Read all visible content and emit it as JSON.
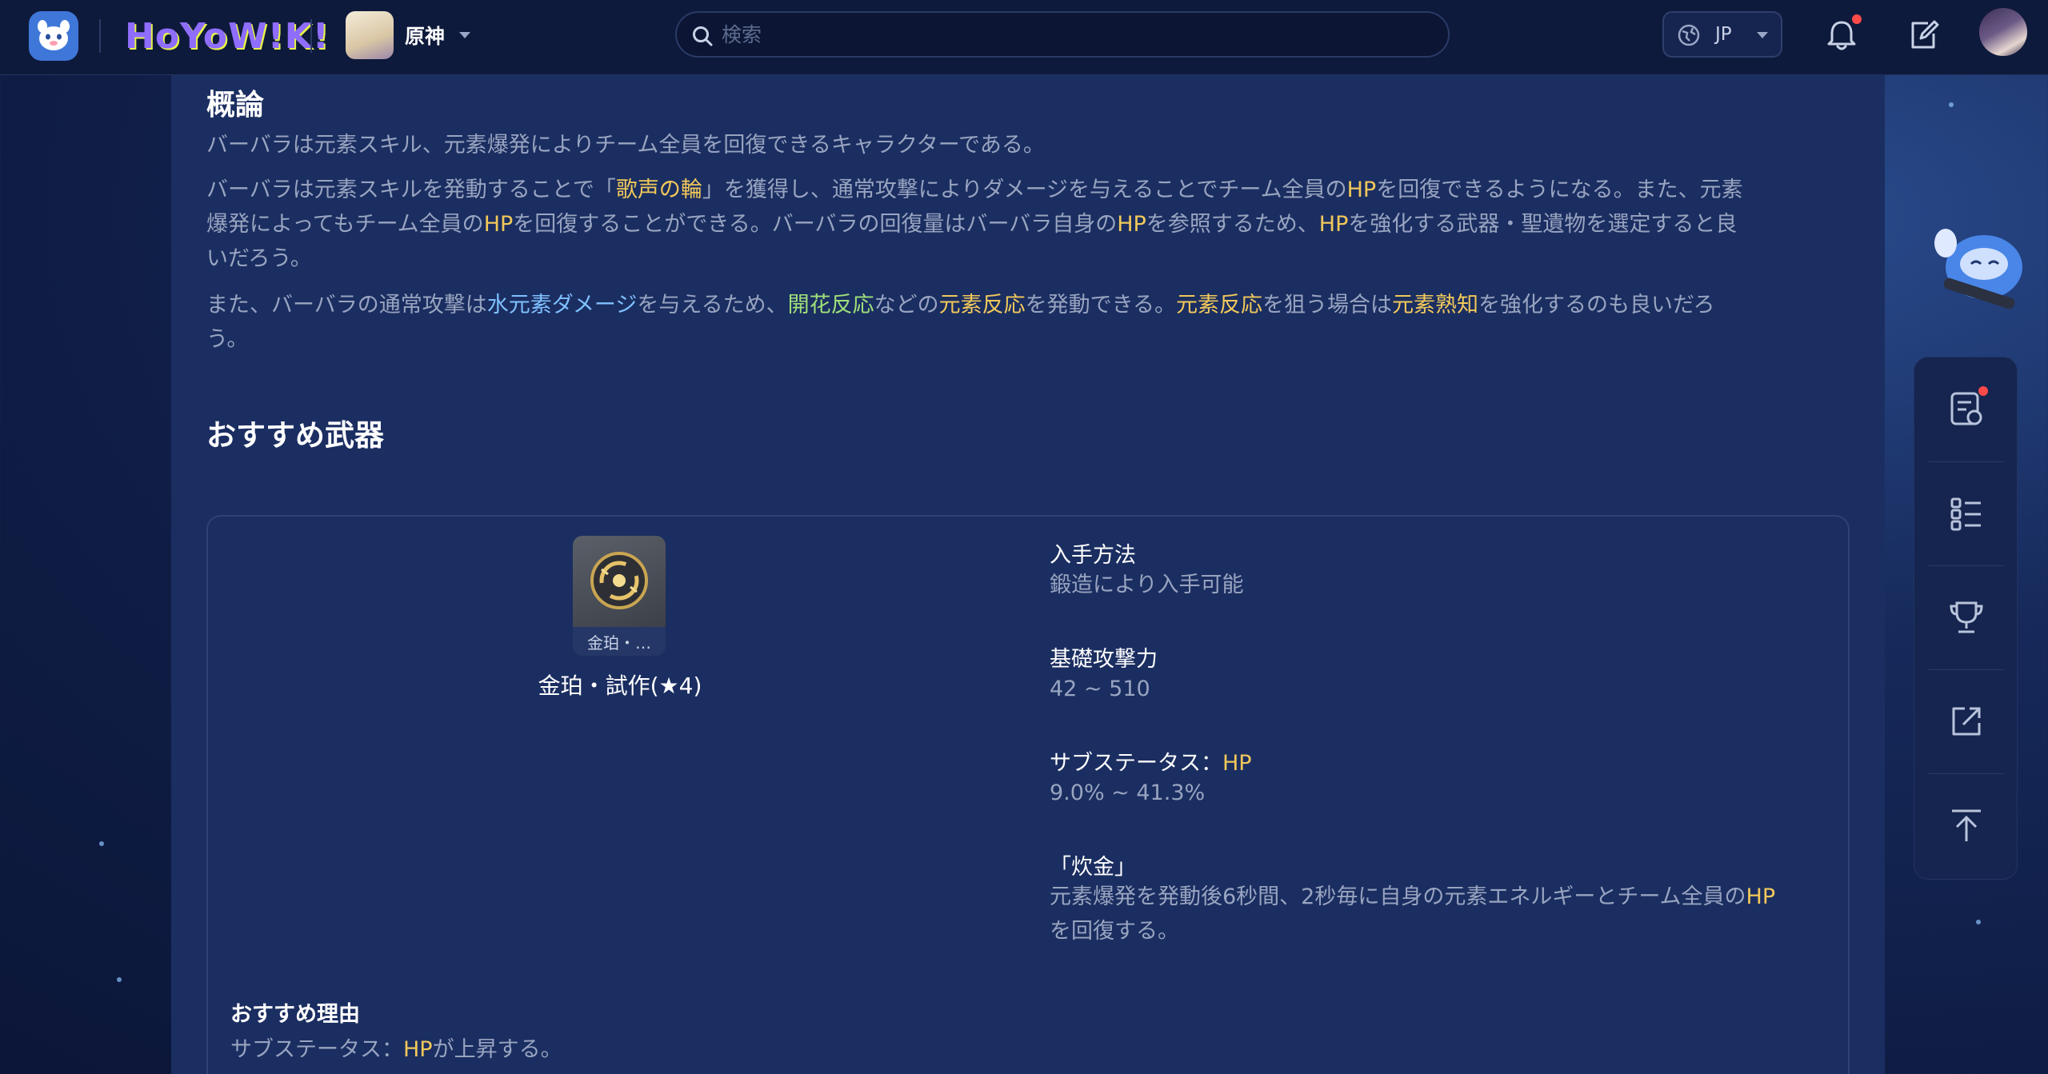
{
  "header": {
    "brand": "HoYoW!K!",
    "game_name": "原神",
    "search_placeholder": "検索",
    "language": "JP"
  },
  "overview": {
    "title": "概論",
    "p1": "バーバラは元素スキル、元素爆発によりチーム全員を回復できるキャラクターである。",
    "p2": {
      "a": "バーバラは元素スキルを発動することで「",
      "b": "歌声の輪",
      "c": "」を獲得し、通常攻撃によりダメージを与えることでチーム全員の",
      "d": "HP",
      "e": "を回復できるようになる。また、元素",
      "f": "爆発によってもチーム全員の",
      "g": "HP",
      "h": "を回復することができる。バーバラの回復量はバーバラ自身の",
      "i": "HP",
      "j": "を参照するため、",
      "k": "HP",
      "l": "を強化する武器・聖遺物を選定すると良",
      "m": "いだろう。"
    },
    "p3": {
      "a": "また、バーバラの通常攻撃は",
      "b": "水元素ダメージ",
      "c": "を与えるため、",
      "d": "開花反応",
      "e": "などの",
      "f": "元素反応",
      "g": "を発動できる。",
      "h": "元素反応",
      "i": "を狙う場合は",
      "j": "元素熟知",
      "k": "を強化するのも良いだろ",
      "l": "う。"
    }
  },
  "weapon_section": {
    "title": "おすすめ武器",
    "weapon": {
      "caption": "金珀・…",
      "name": "金珀・試作(★4)"
    },
    "stats": {
      "obtain_label": "入手方法",
      "obtain_value": "鍛造により入手可能",
      "atk_label": "基礎攻撃力",
      "atk_value": "42 ~ 510",
      "sub_label_prefix": "サブステータス：",
      "sub_label_stat": "HP",
      "sub_value": "9.0% ~ 41.3%",
      "passive_label": "「炊金」",
      "passive_a": "元素爆発を発動後6秒間、2秒毎に自身の元素エネルギーとチーム全員の",
      "passive_b": "HP",
      "passive_c": "を回復する。"
    },
    "reason": {
      "title": "おすすめ理由",
      "prefix": "サブステータス：",
      "stat": "HP",
      "suffix": "が上昇する。"
    }
  },
  "icons": {
    "app": "mascot-logo-icon",
    "search": "search-icon",
    "globe": "globe-icon",
    "bell": "bell-icon",
    "edit": "edit-icon",
    "side": [
      "task-icon",
      "list-icon",
      "trophy-icon",
      "share-icon",
      "back-to-top-icon"
    ]
  },
  "colors": {
    "accent_gold": "#f1c85a",
    "accent_blue": "#7fc0ff",
    "accent_green": "#9fe07a",
    "notify_red": "#ff4a4a"
  }
}
